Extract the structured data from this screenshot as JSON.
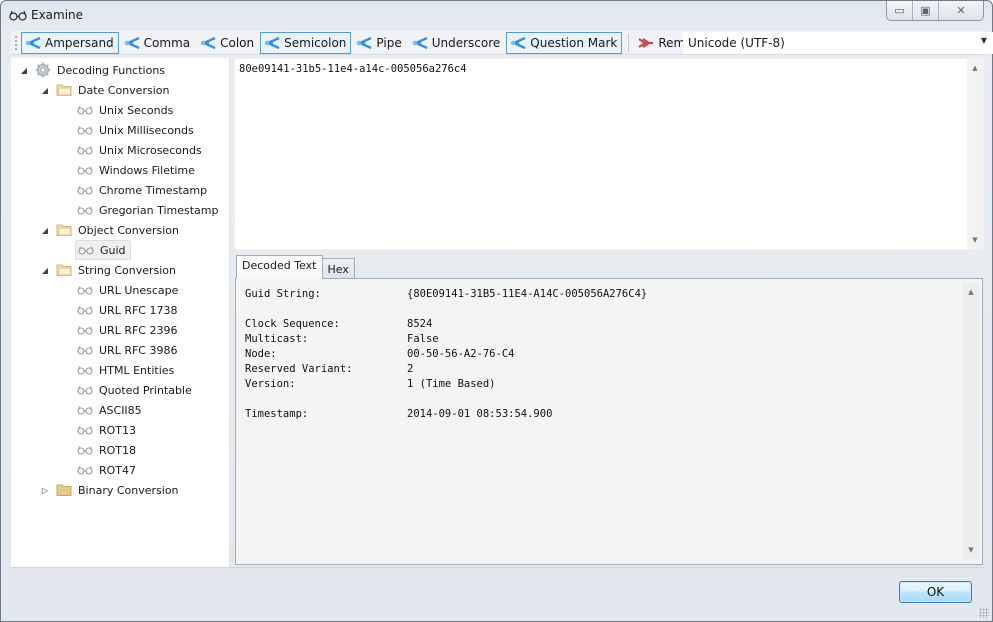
{
  "window": {
    "title": "Examine",
    "controls": {
      "minimize": "minimize",
      "maximize": "maximize",
      "close": "close"
    }
  },
  "toolbar": {
    "buttons": [
      {
        "label": "Ampersand",
        "icon": "split-icon",
        "checked": true
      },
      {
        "label": "Comma",
        "icon": "split-icon",
        "checked": false
      },
      {
        "label": "Colon",
        "icon": "split-icon",
        "checked": false
      },
      {
        "label": "Semicolon",
        "icon": "split-icon",
        "checked": true
      },
      {
        "label": "Pipe",
        "icon": "split-icon",
        "checked": false
      },
      {
        "label": "Underscore",
        "icon": "split-icon",
        "checked": false
      },
      {
        "label": "Question Mark",
        "icon": "split-icon",
        "checked": true
      }
    ],
    "remove_splits": "Remove Splits",
    "encoding": "Unicode (UTF-8)"
  },
  "tree": {
    "root": "Decoding Functions",
    "groups": [
      {
        "label": "Date Conversion",
        "expanded": true,
        "items": [
          "Unix Seconds",
          "Unix Milliseconds",
          "Unix Microseconds",
          "Windows Filetime",
          "Chrome Timestamp",
          "Gregorian Timestamp"
        ]
      },
      {
        "label": "Object Conversion",
        "expanded": true,
        "items": [
          "Guid"
        ]
      },
      {
        "label": "String Conversion",
        "expanded": true,
        "items": [
          "URL Unescape",
          "URL RFC 1738",
          "URL RFC 2396",
          "URL RFC 3986",
          "HTML Entities",
          "Quoted Printable",
          "ASCII85",
          "ROT13",
          "ROT18",
          "ROT47"
        ]
      },
      {
        "label": "Binary Conversion",
        "expanded": false,
        "items": []
      }
    ],
    "selected": "Guid"
  },
  "input": {
    "value": "80e09141-31b5-11e4-a14c-005056a276c4"
  },
  "tabs": [
    {
      "label": "Decoded Text",
      "active": true
    },
    {
      "label": "Hex",
      "active": false
    }
  ],
  "output": {
    "rows": [
      {
        "key": "Guid String:",
        "value": "{80E09141-31B5-11E4-A14C-005056A276C4}"
      },
      {
        "key": "Clock Sequence:",
        "value": "8524"
      },
      {
        "key": "Multicast:",
        "value": "False"
      },
      {
        "key": "Node:",
        "value": "00-50-56-A2-76-C4"
      },
      {
        "key": "Reserved Variant:",
        "value": "2"
      },
      {
        "key": "Version:",
        "value": "1 (Time Based)"
      },
      {
        "key": "Timestamp:",
        "value": "2014-09-01 08:53:54.900"
      }
    ]
  },
  "footer": {
    "ok_label": "OK"
  },
  "colors": {
    "accent": "#5c9bd1",
    "split_icon": "#3a8fd6",
    "remove_icon": "#c9474a",
    "folder": "#e8c98e"
  }
}
